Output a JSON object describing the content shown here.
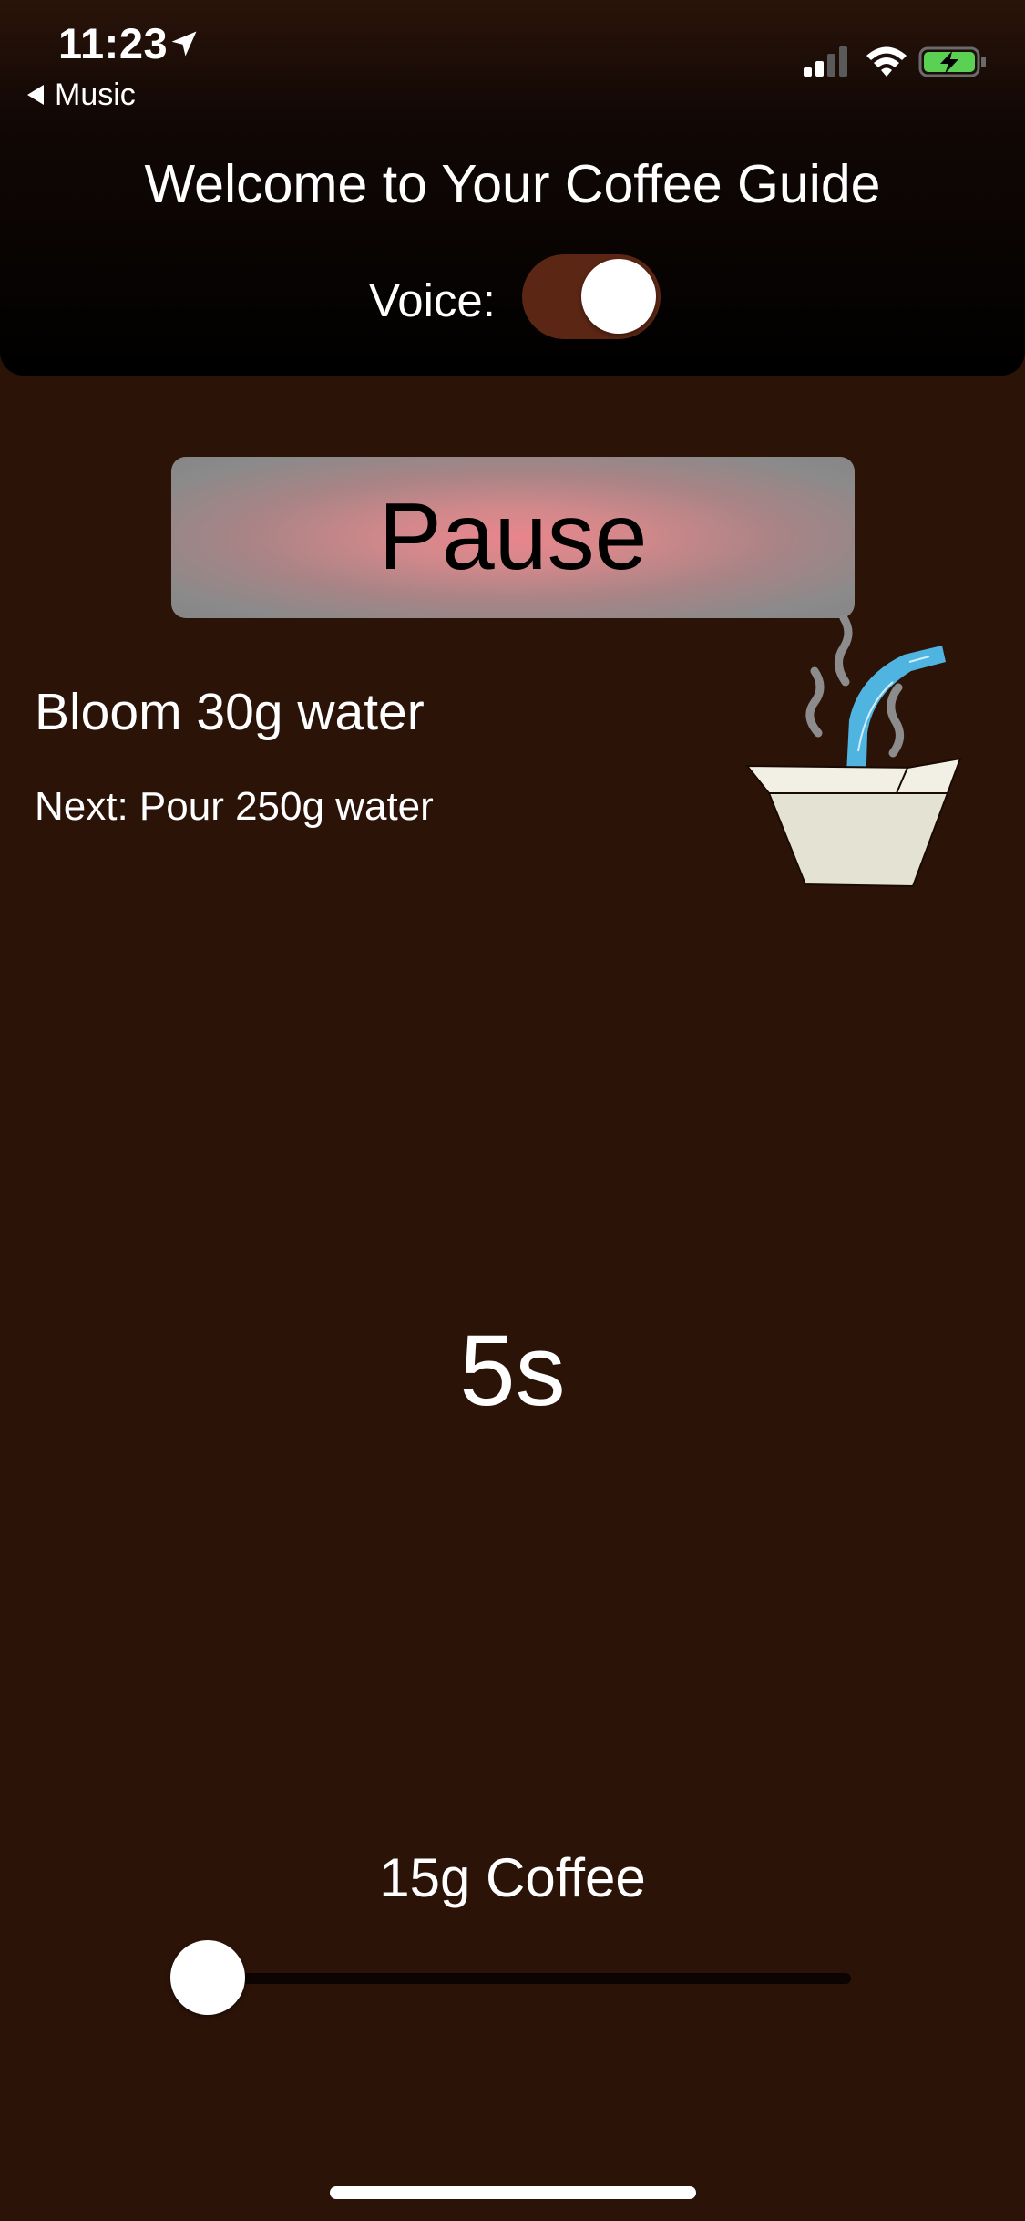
{
  "status_bar": {
    "time": "11:23",
    "back_label": "Music",
    "icons": [
      "location-arrow-icon",
      "cellular-signal-icon",
      "wifi-icon",
      "battery-charging-icon"
    ]
  },
  "header": {
    "title": "Welcome to Your Coffee Guide",
    "voice_label": "Voice:",
    "voice_enabled": true
  },
  "controls": {
    "pause_label": "Pause"
  },
  "steps": {
    "current": "Bloom 30g water",
    "next": "Next: Pour 250g water"
  },
  "timer": {
    "display": "5s"
  },
  "coffee": {
    "label": "15g Coffee",
    "slider_fraction": 0.0
  },
  "colors": {
    "background": "#2c1308",
    "toggle_on": "#5c2614",
    "button_center": "#e8868c",
    "button_edge": "#868686",
    "water": "#4fb4e0",
    "filter": "#e4e2d3"
  }
}
